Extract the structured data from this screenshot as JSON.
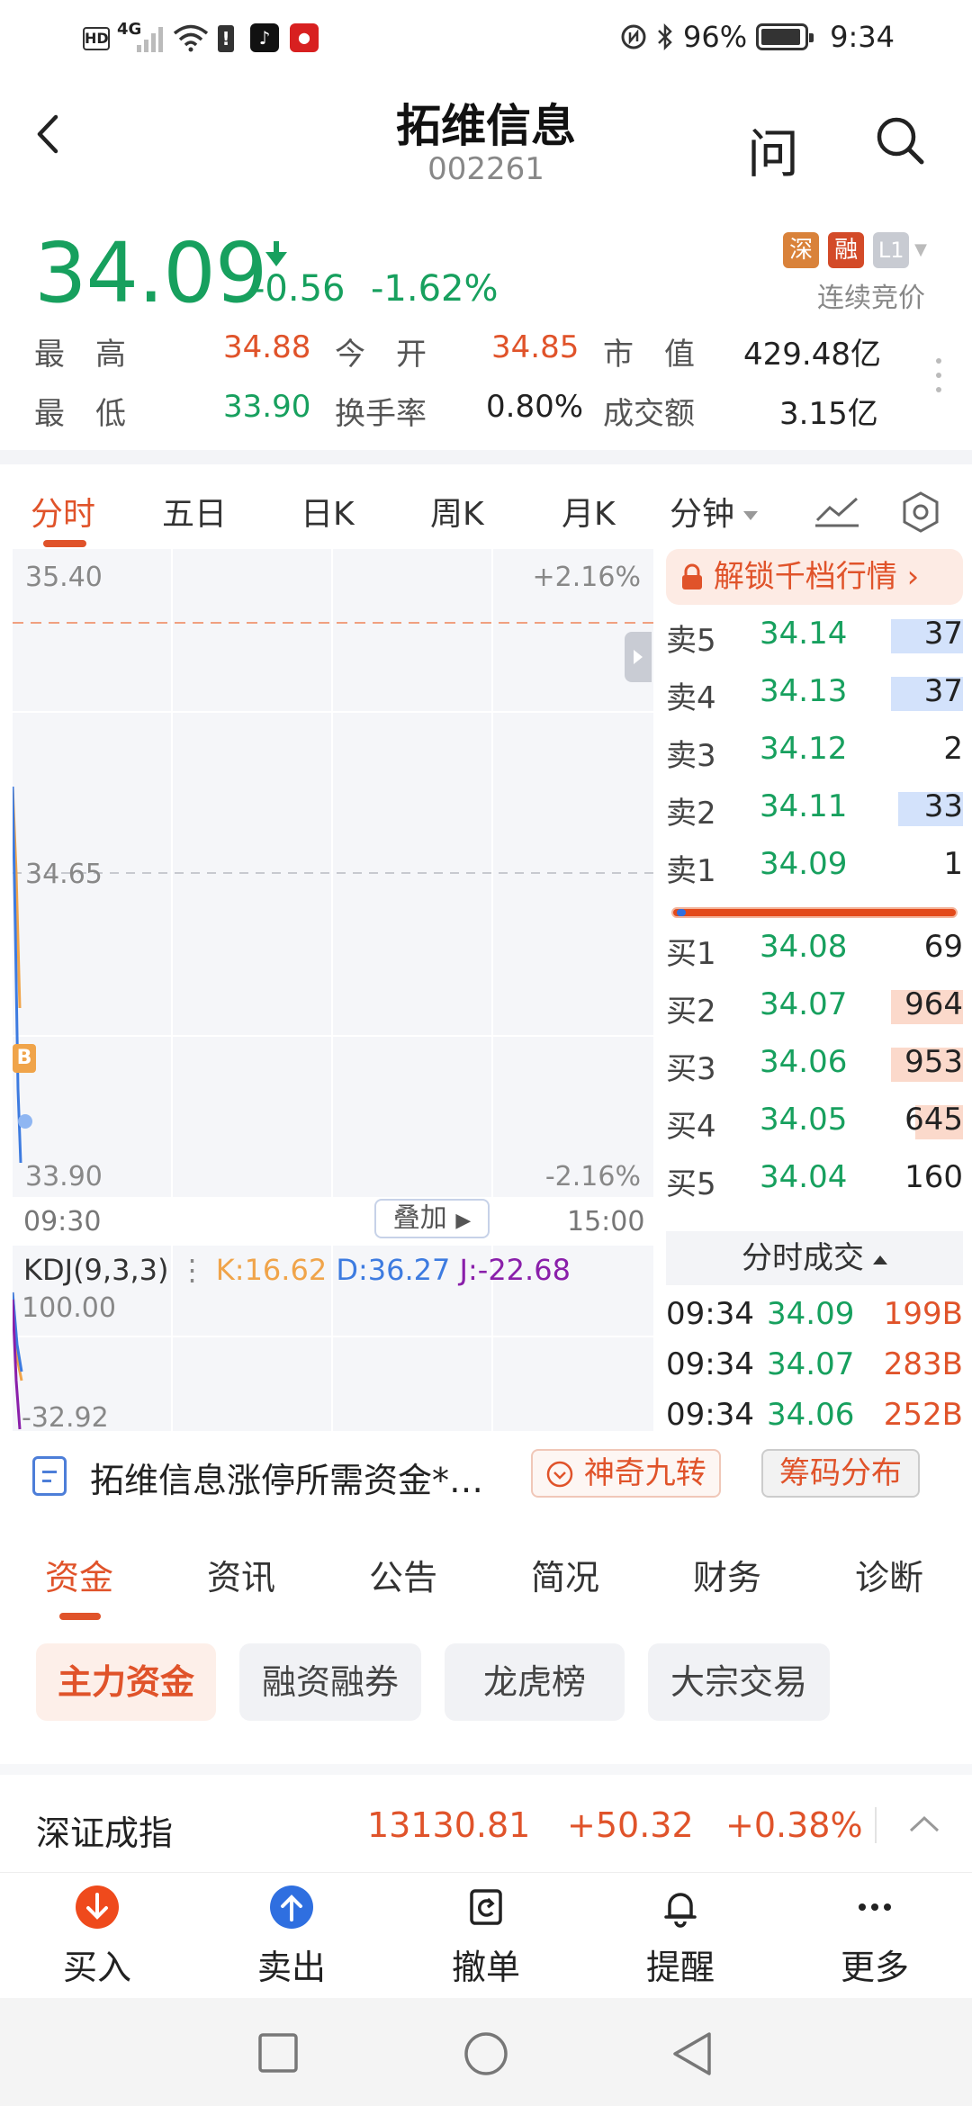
{
  "status_bar": {
    "hd": "HD",
    "network": "4G",
    "battery_pct": "96%",
    "time": "9:34",
    "icons": [
      "hd-icon",
      "signal-icon",
      "wifi-icon",
      "alert-icon",
      "tiktok-icon",
      "app-icon",
      "nfc-icon",
      "bluetooth-icon",
      "battery-icon"
    ]
  },
  "header": {
    "stock_name": "拓维信息",
    "stock_code": "002261",
    "ask_label": "问"
  },
  "quote": {
    "last_price": "34.09",
    "change": "-0.56",
    "change_pct": "-1.62%",
    "badges": [
      "深",
      "融",
      "L1"
    ],
    "auction_label": "连续竞价",
    "stats": [
      {
        "label": "最　高",
        "value": "34.88"
      },
      {
        "label": "今　开",
        "value": "34.85"
      },
      {
        "label": "市　值",
        "value": "429.48亿"
      },
      {
        "label": "最　低",
        "value": "33.90"
      },
      {
        "label": "换手率",
        "value": "0.80%"
      },
      {
        "label": "成交额",
        "value": "3.15亿"
      }
    ],
    "price_up_color": "#e0532a",
    "price_down_color": "#17a05e"
  },
  "chart_tabs": [
    "分时",
    "五日",
    "日K",
    "周K",
    "月K",
    "分钟"
  ],
  "chart": {
    "y_high": "35.40",
    "y_mid": "34.65",
    "y_low": "33.90",
    "pct_high": "+2.16%",
    "pct_low": "-2.16%",
    "time_start": "09:30",
    "time_end": "15:00",
    "overlay_label": "叠加",
    "b_marker": "B",
    "kdj_title": "KDJ(9,3,3)",
    "kdj_k": "K:16.62",
    "kdj_d": "D:36.27",
    "kdj_j": "J:-22.68",
    "kdj_top": "100.00",
    "kdj_bottom": "-32.92"
  },
  "order_book": {
    "unlock_label": "解锁千档行情",
    "asks": [
      {
        "side": "卖5",
        "price": "34.14",
        "vol": "37",
        "bar": 0.5
      },
      {
        "side": "卖4",
        "price": "34.13",
        "vol": "37",
        "bar": 0.5
      },
      {
        "side": "卖3",
        "price": "34.12",
        "vol": "2",
        "bar": 0.0
      },
      {
        "side": "卖2",
        "price": "34.11",
        "vol": "33",
        "bar": 0.45
      },
      {
        "side": "卖1",
        "price": "34.09",
        "vol": "1",
        "bar": 0.0
      }
    ],
    "bids": [
      {
        "side": "买1",
        "price": "34.08",
        "vol": "69",
        "bar": 0.0
      },
      {
        "side": "买2",
        "price": "34.07",
        "vol": "964",
        "bar": 0.5
      },
      {
        "side": "买3",
        "price": "34.06",
        "vol": "953",
        "bar": 0.5
      },
      {
        "side": "买4",
        "price": "34.05",
        "vol": "645",
        "bar": 0.33
      },
      {
        "side": "买5",
        "price": "34.04",
        "vol": "160",
        "bar": 0.0
      }
    ],
    "trades_label": "分时成交",
    "trades": [
      {
        "time": "09:34",
        "price": "34.09",
        "vol": "199B"
      },
      {
        "time": "09:34",
        "price": "34.07",
        "vol": "283B"
      },
      {
        "time": "09:34",
        "price": "34.06",
        "vol": "252B"
      }
    ]
  },
  "info_strip": {
    "news_title": "拓维信息涨停所需资金*…",
    "chip1": "神奇九转",
    "chip2": "筹码分布"
  },
  "section_tabs": [
    "资金",
    "资讯",
    "公告",
    "简况",
    "财务",
    "诊断"
  ],
  "sub_chips": [
    "主力资金",
    "融资融券",
    "龙虎榜",
    "大宗交易"
  ],
  "index_ticker": {
    "name": "深证成指",
    "value": "13130.81",
    "change": "+50.32",
    "change_pct": "+0.38%"
  },
  "toolbar": [
    {
      "label": "买入",
      "icon": "buy-icon"
    },
    {
      "label": "卖出",
      "icon": "sell-icon"
    },
    {
      "label": "撤单",
      "icon": "cancel-order-icon"
    },
    {
      "label": "提醒",
      "icon": "bell-icon"
    },
    {
      "label": "更多",
      "icon": "more-icon"
    }
  ]
}
